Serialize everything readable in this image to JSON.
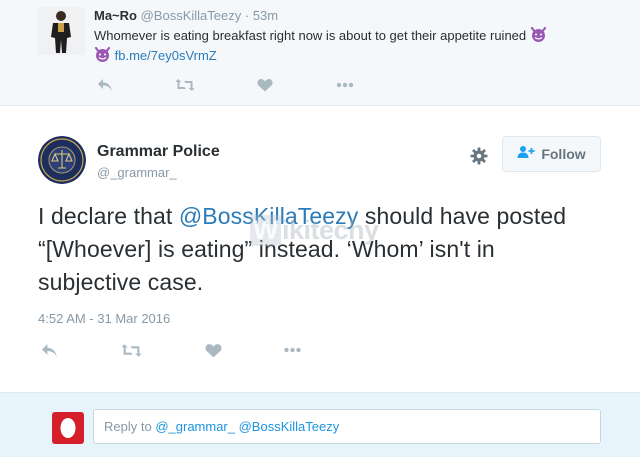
{
  "context_tweet": {
    "name": "Ma~Ro",
    "handle": "@BossKillaTeezy",
    "separator": "·",
    "time": "53m",
    "text": "Whomever is eating breakfast right now is about to get their appetite ruined",
    "link": "fb.me/7ey0sVrmZ",
    "emoji": "smiling-imp"
  },
  "main_tweet": {
    "name": "Grammar Police",
    "handle": "@_grammar_",
    "follow_label": "Follow",
    "text_prefix": "I declare that ",
    "mention": "@BossKillaTeezy",
    "text_suffix": " should have posted “[Whoever] is eating” instead. ‘Whom’ isn't in subjective case.",
    "timestamp": "4:52 AM - 31 Mar 2016"
  },
  "watermark": {
    "box_letter": "W",
    "rest": "ikitechy"
  },
  "reply": {
    "prefix": "Reply to",
    "recipients": "@_grammar_ @BossKillaTeezy"
  },
  "colors": {
    "link": "#2b7bb9",
    "muted": "#8899a6",
    "text": "#292f33",
    "reply_bg": "#e8f4fb",
    "context_bg": "#f5f8fa",
    "emoji_purple": "#9b59b6"
  },
  "icons": [
    "reply-icon",
    "retweet-icon",
    "like-icon",
    "more-icon",
    "gear-icon",
    "follow-person-icon"
  ]
}
